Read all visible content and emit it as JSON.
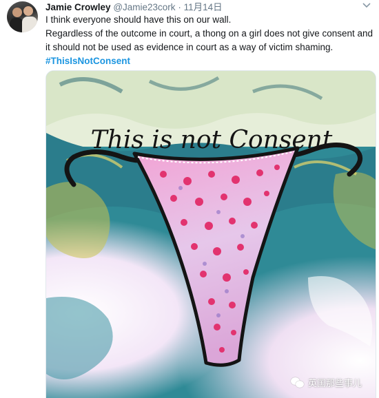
{
  "tweet": {
    "display_name": "Jamie Crowley",
    "handle": "@Jamie23cork",
    "separator": "·",
    "timestamp": "11月14日",
    "line1": "I think everyone should have this on our wall.",
    "line2": "Regardless of the outcome in court, a thong on a girl does not give consent and it should not be used as evidence in court as a way of victim shaming.",
    "hashtag": "#ThisIsNotConsent",
    "caret_icon": "chevron-down-icon"
  },
  "media": {
    "image_text": "This is not Consent"
  },
  "watermark": {
    "icon": "wechat-icon",
    "text": "英国那些事儿"
  },
  "colors": {
    "link": "#1b95e0",
    "secondary_text": "#657786",
    "text": "#14171a"
  }
}
